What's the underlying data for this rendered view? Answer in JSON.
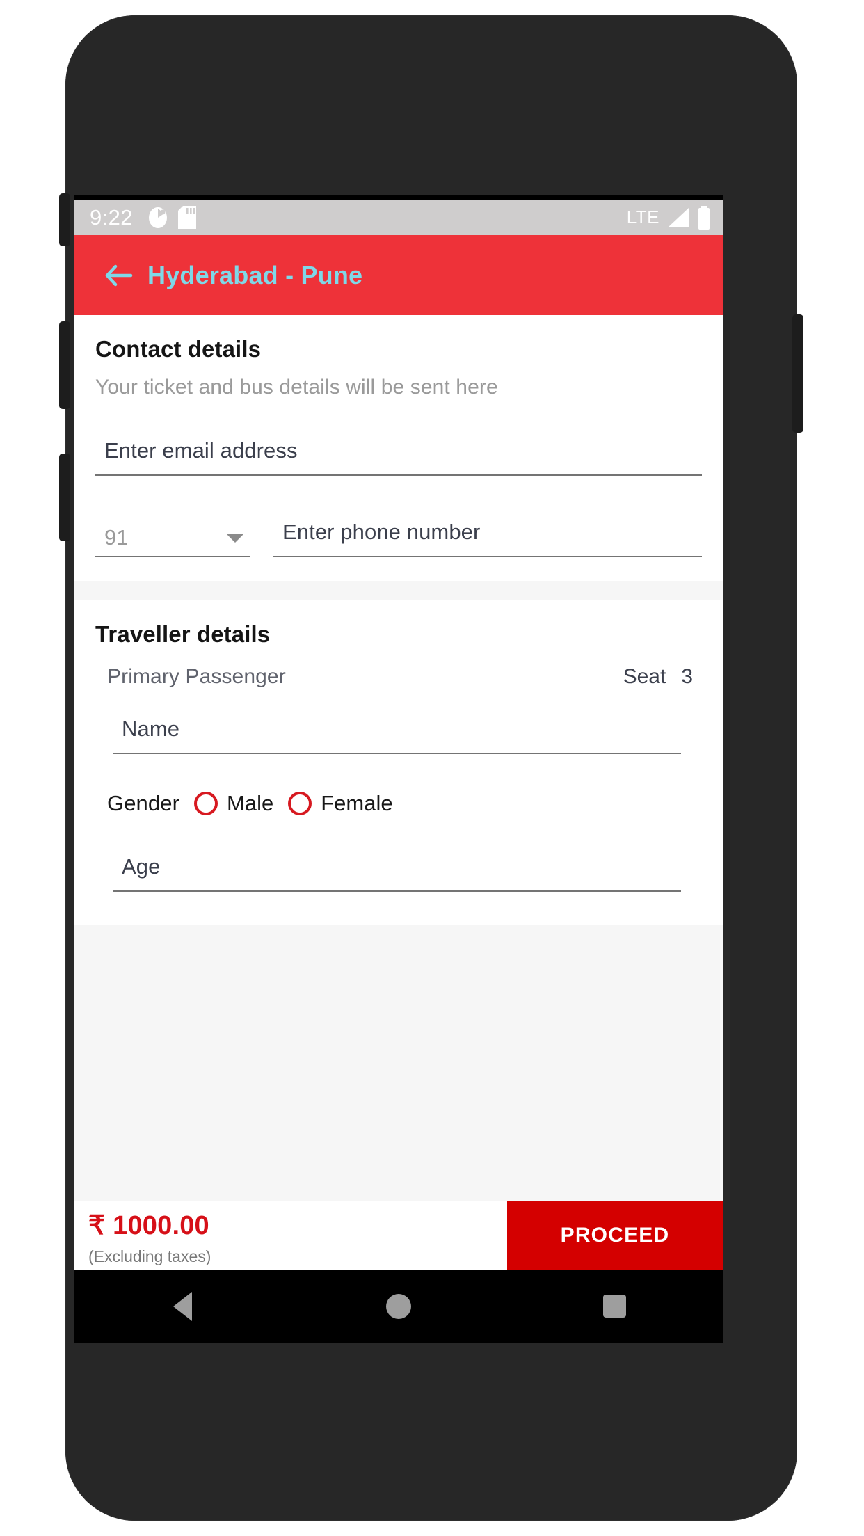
{
  "status_bar": {
    "time": "9:22",
    "left_icons": [
      "mouse-pointer-icon",
      "sd-card-icon"
    ],
    "network_label": "LTE",
    "right_icons": [
      "signal-strength-icon",
      "battery-icon"
    ]
  },
  "app_bar": {
    "back_icon": "arrow-left-icon",
    "title": "Hyderabad - Pune",
    "background_color": "#EE3239",
    "title_color": "#7FD8E8"
  },
  "contact_section": {
    "title": "Contact details",
    "subtitle": "Your ticket and bus details will be sent here",
    "email": {
      "placeholder": "Enter email address",
      "value": ""
    },
    "country_code": {
      "selected": "91",
      "caret_icon": "chevron-down-icon"
    },
    "phone": {
      "placeholder": "Enter phone number",
      "value": ""
    }
  },
  "traveller_section": {
    "title": "Traveller details",
    "passenger_label": "Primary Passenger",
    "seat_label": "Seat",
    "seat_number": "3",
    "name": {
      "placeholder": "Name",
      "value": ""
    },
    "gender": {
      "label": "Gender",
      "options": [
        {
          "label": "Male",
          "selected": false
        },
        {
          "label": "Female",
          "selected": false
        }
      ],
      "accent_color": "#D71920"
    },
    "age": {
      "placeholder": "Age",
      "value": ""
    }
  },
  "bottom_bar": {
    "price": "₹ 1000.00",
    "price_note": "(Excluding taxes)",
    "price_color": "#D61018",
    "proceed_label": "PROCEED",
    "proceed_color": "#D40000"
  },
  "nav_bar": {
    "back_icon": "triangle-back-icon",
    "home_icon": "circle-home-icon",
    "recents_icon": "square-recents-icon"
  }
}
